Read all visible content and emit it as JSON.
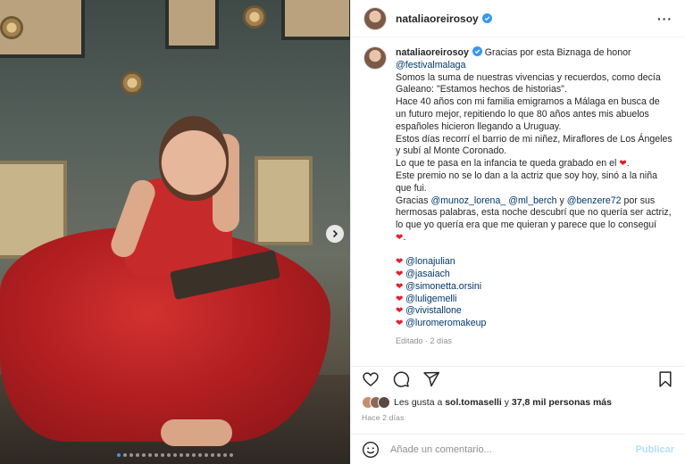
{
  "post": {
    "username": "nataliaoreirosoy",
    "more_icon": "more-horizontal-icon"
  },
  "caption": {
    "username": "nataliaoreirosoy",
    "lines": [
      {
        "parts": [
          {
            "text": "Gracias por esta Biznaga de honor"
          }
        ]
      },
      {
        "parts": [
          {
            "text": "@festivalmalaga",
            "mention": true
          }
        ]
      },
      {
        "parts": [
          {
            "text": "Somos la suma de nuestras vivencias y recuerdos, como decía"
          }
        ]
      },
      {
        "parts": [
          {
            "text": "Galeano: \"Estamos hechos de historias\"."
          }
        ]
      },
      {
        "parts": [
          {
            "text": "Hace 40 años con mi familia emigramos a Málaga en busca de"
          }
        ]
      },
      {
        "parts": [
          {
            "text": "un futuro mejor, repitiendo lo que 80 años antes mis abuelos"
          }
        ]
      },
      {
        "parts": [
          {
            "text": "españoles hicieron llegando a Uruguay."
          }
        ]
      },
      {
        "parts": [
          {
            "text": "Estos días recorrí el barrio de mi niñez, Miraflores de Los Ángeles"
          }
        ]
      },
      {
        "parts": [
          {
            "text": "y subí al Monte Coronado."
          }
        ]
      },
      {
        "parts": [
          {
            "text": "Lo que te pasa en la infancia te queda grabado en el "
          },
          {
            "text": "❤",
            "heart": true
          },
          {
            "text": "."
          }
        ]
      },
      {
        "parts": [
          {
            "text": "Este premio no se lo dan a la actriz que soy hoy, sinó a la niña"
          }
        ]
      },
      {
        "parts": [
          {
            "text": "que fui."
          }
        ]
      },
      {
        "parts": [
          {
            "text": "Gracias "
          },
          {
            "text": "@munoz_lorena_",
            "mention": true
          },
          {
            "text": " "
          },
          {
            "text": "@ml_berch",
            "mention": true
          },
          {
            "text": " y "
          },
          {
            "text": "@benzere72",
            "mention": true
          },
          {
            "text": " por sus"
          }
        ]
      },
      {
        "parts": [
          {
            "text": "hermosas palabras, esta noche descubrí que no quería ser actriz,"
          }
        ]
      },
      {
        "parts": [
          {
            "text": "lo que yo quería era que me quieran y parece que lo conseguí"
          }
        ]
      },
      {
        "parts": [
          {
            "text": "❤",
            "heart": true
          },
          {
            "text": "."
          }
        ]
      }
    ],
    "tags": [
      "@lonajulian",
      "@jasaiach",
      "@simonetta.orsini",
      "@luligemelli",
      "@vivistallone",
      "@luromeromakeup"
    ],
    "edited": "Editado · 2 días"
  },
  "likes": {
    "prefix": "Les gusta a ",
    "user": "sol.tomaselli",
    "middle": " y ",
    "count": "37,8 mil personas más"
  },
  "time": "Hace 2 días",
  "comment": {
    "placeholder": "Añade un comentario...",
    "publish": "Publicar"
  },
  "colors": {
    "mention": "#00376b",
    "heart": "#e0202e",
    "publish": "#b2dffc",
    "active_dot": "#3897f0"
  },
  "carousel": {
    "count": 19,
    "active": 0
  }
}
